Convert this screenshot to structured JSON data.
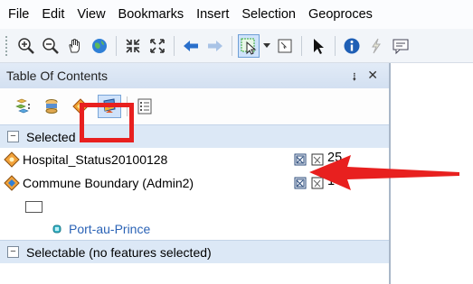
{
  "menubar": {
    "items": [
      "File",
      "Edit",
      "View",
      "Bookmarks",
      "Insert",
      "Selection",
      "Geoproces"
    ]
  },
  "toolbar": {
    "icons": [
      "zoom-in-icon",
      "zoom-out-icon",
      "pan-hand-icon",
      "globe-full-extent-icon",
      "fixed-zoom-in-icon",
      "fixed-zoom-out-icon",
      "back-arrow-icon",
      "forward-arrow-icon",
      "select-features-icon",
      "clear-selection-icon",
      "select-elements-icon",
      "identify-icon",
      "hyperlink-icon",
      "html-popup-icon"
    ]
  },
  "toc": {
    "title": "Table Of Contents",
    "pin_glyph": "⭭",
    "close_glyph": "✕",
    "groups": [
      {
        "label": "Selected",
        "expander": "−",
        "layers": [
          {
            "name": "Hospital_Status20100128",
            "count": "25"
          },
          {
            "name": "Commune Boundary (Admin2)",
            "count": "1"
          }
        ]
      },
      {
        "label": "Selectable (no features selected)",
        "expander": "−"
      }
    ],
    "sublayer": "Port-au-Prince"
  },
  "colors": {
    "highlight": "#e8201f",
    "arrow": "#e8201f",
    "sublayer_text": "#2b63b6"
  }
}
